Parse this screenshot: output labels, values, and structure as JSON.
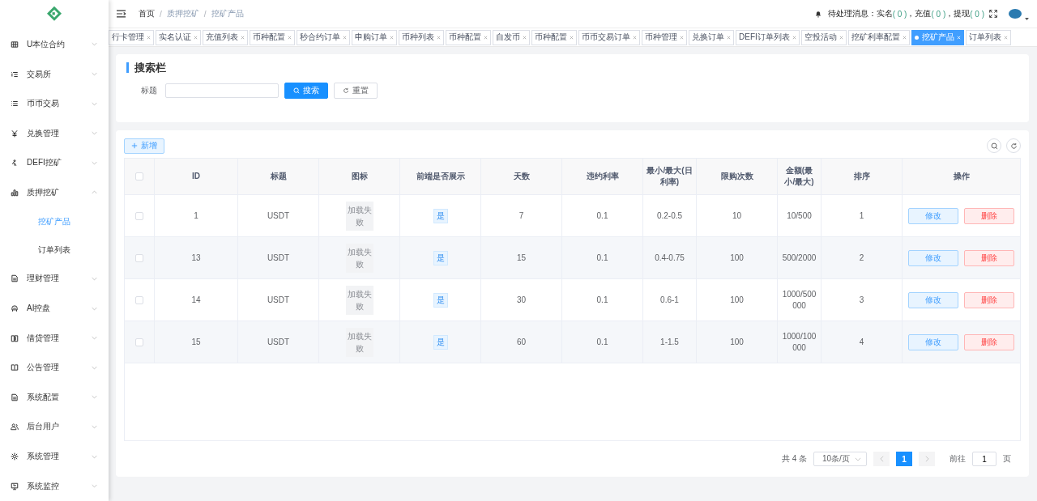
{
  "sidebar": {
    "items": [
      {
        "label": "U本位合约",
        "expanded": false
      },
      {
        "label": "交易所",
        "expanded": false
      },
      {
        "label": "币币交易",
        "expanded": false
      },
      {
        "label": "兑换管理",
        "expanded": false
      },
      {
        "label": "DEFI挖矿",
        "expanded": false
      },
      {
        "label": "质押挖矿",
        "expanded": true,
        "children": [
          {
            "label": "挖矿产品",
            "selected": true
          },
          {
            "label": "订单列表",
            "selected": false
          }
        ]
      },
      {
        "label": "理财管理",
        "expanded": false
      },
      {
        "label": "AI控盘",
        "expanded": false
      },
      {
        "label": "借贷管理",
        "expanded": false
      },
      {
        "label": "公告管理",
        "expanded": false
      },
      {
        "label": "系统配置",
        "expanded": false
      },
      {
        "label": "后台用户",
        "expanded": false
      },
      {
        "label": "系统管理",
        "expanded": false
      },
      {
        "label": "系统监控",
        "expanded": false
      }
    ]
  },
  "breadcrumb": [
    {
      "label": "首页"
    },
    {
      "separator": "/",
      "label": "质押挖矿"
    },
    {
      "separator": "/",
      "label": "挖矿产品"
    }
  ],
  "notice": {
    "items": [
      {
        "label": "待处理消息：实名",
        "count": "( 0 )"
      },
      {
        "label": "，充值",
        "count": "( 0 )"
      },
      {
        "label": "，提现",
        "count": "( 0 )"
      }
    ]
  },
  "tabs": [
    {
      "label": "行卡管理",
      "selected": false
    },
    {
      "label": "实名认证",
      "selected": false
    },
    {
      "label": "充值列表",
      "selected": false
    },
    {
      "label": "币种配置",
      "selected": false
    },
    {
      "label": "秒合约订单",
      "selected": false
    },
    {
      "label": "申购订单",
      "selected": false
    },
    {
      "label": "币种列表",
      "selected": false
    },
    {
      "label": "币种配置",
      "selected": false
    },
    {
      "label": "自发币",
      "selected": false
    },
    {
      "label": "币种配置",
      "selected": false
    },
    {
      "label": "币币交易订单",
      "selected": false
    },
    {
      "label": "币种管理",
      "selected": false
    },
    {
      "label": "兑换订单",
      "selected": false
    },
    {
      "label": "DEFI订单列表",
      "selected": false
    },
    {
      "label": "空投活动",
      "selected": false
    },
    {
      "label": "挖矿利率配置",
      "selected": false
    },
    {
      "label": "挖矿产品",
      "selected": true
    },
    {
      "label": "订单列表",
      "selected": false
    }
  ],
  "search": {
    "title": "搜索栏",
    "field_label": "标题",
    "search_button": "搜索",
    "reset_button": "重置"
  },
  "add_button": "新增",
  "table": {
    "select_all_checked": false,
    "columns": [
      "ID",
      "标题",
      "图标",
      "前端是否展示",
      "天数",
      "违约利率",
      "最小/最大(日利率)",
      "限购次数",
      "金额(最小/最大)",
      "排序",
      "操作"
    ],
    "rows": [
      {
        "checked": false,
        "id": "1",
        "title": "USDT",
        "image": "加载失败",
        "shown": "是",
        "days": "7",
        "penalty_rate": "0.1",
        "daily_rate": "0.2-0.5",
        "limit": "10",
        "amount": "10/500",
        "sort": "1",
        "edit": "修改",
        "delete": "删除"
      },
      {
        "checked": false,
        "id": "13",
        "title": "USDT",
        "image": "加载失败",
        "shown": "是",
        "days": "15",
        "penalty_rate": "0.1",
        "daily_rate": "0.4-0.75",
        "limit": "100",
        "amount": "500/2000",
        "sort": "2",
        "edit": "修改",
        "delete": "删除"
      },
      {
        "checked": false,
        "id": "14",
        "title": "USDT",
        "image": "加载失败",
        "shown": "是",
        "days": "30",
        "penalty_rate": "0.1",
        "daily_rate": "0.6-1",
        "limit": "100",
        "amount": "1000/500000",
        "sort": "3",
        "edit": "修改",
        "delete": "删除"
      },
      {
        "checked": false,
        "id": "15",
        "title": "USDT",
        "image": "加载失败",
        "shown": "是",
        "days": "60",
        "penalty_rate": "0.1",
        "daily_rate": "1-1.5",
        "limit": "100",
        "amount": "1000/100000",
        "sort": "4",
        "edit": "修改",
        "delete": "删除"
      }
    ]
  },
  "pagination": {
    "total": "共 4 条",
    "page_size": "10条/页",
    "pages": [
      {
        "label": "1",
        "selected": true
      }
    ],
    "goto_label": "前往",
    "goto_value": "1",
    "page_unit": "页"
  }
}
